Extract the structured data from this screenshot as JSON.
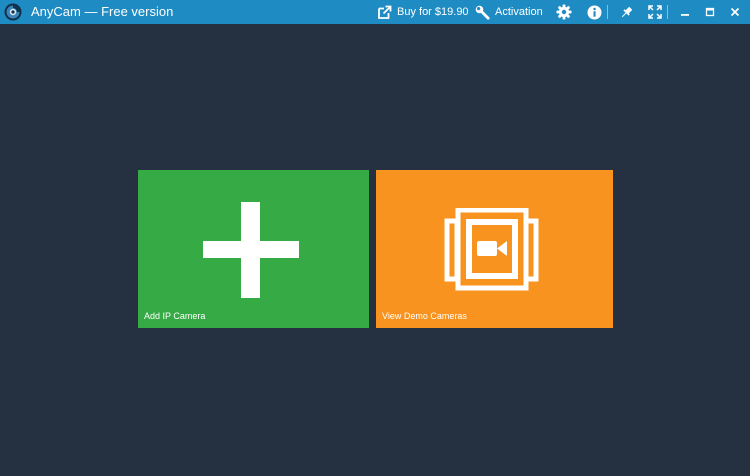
{
  "titlebar": {
    "app_title": "AnyCam — Free version",
    "logo_icon": "anycam-logo-icon",
    "buy_label": "Buy for $19.90",
    "activation_label": "Activation",
    "icons": [
      "external-link-icon",
      "wrench-icon",
      "gear-icon",
      "info-icon",
      "pin-icon",
      "fullscreen-icon",
      "minimize-icon",
      "maximize-icon",
      "close-icon"
    ],
    "background_color": "#1e8bc3"
  },
  "main": {
    "background_color": "#253040",
    "tiles": [
      {
        "label": "Add IP Camera",
        "icon": "plus-icon",
        "color": "#36aa45"
      },
      {
        "label": "View Demo Cameras",
        "icon": "camera-stack-icon",
        "color": "#f7931e"
      }
    ]
  }
}
